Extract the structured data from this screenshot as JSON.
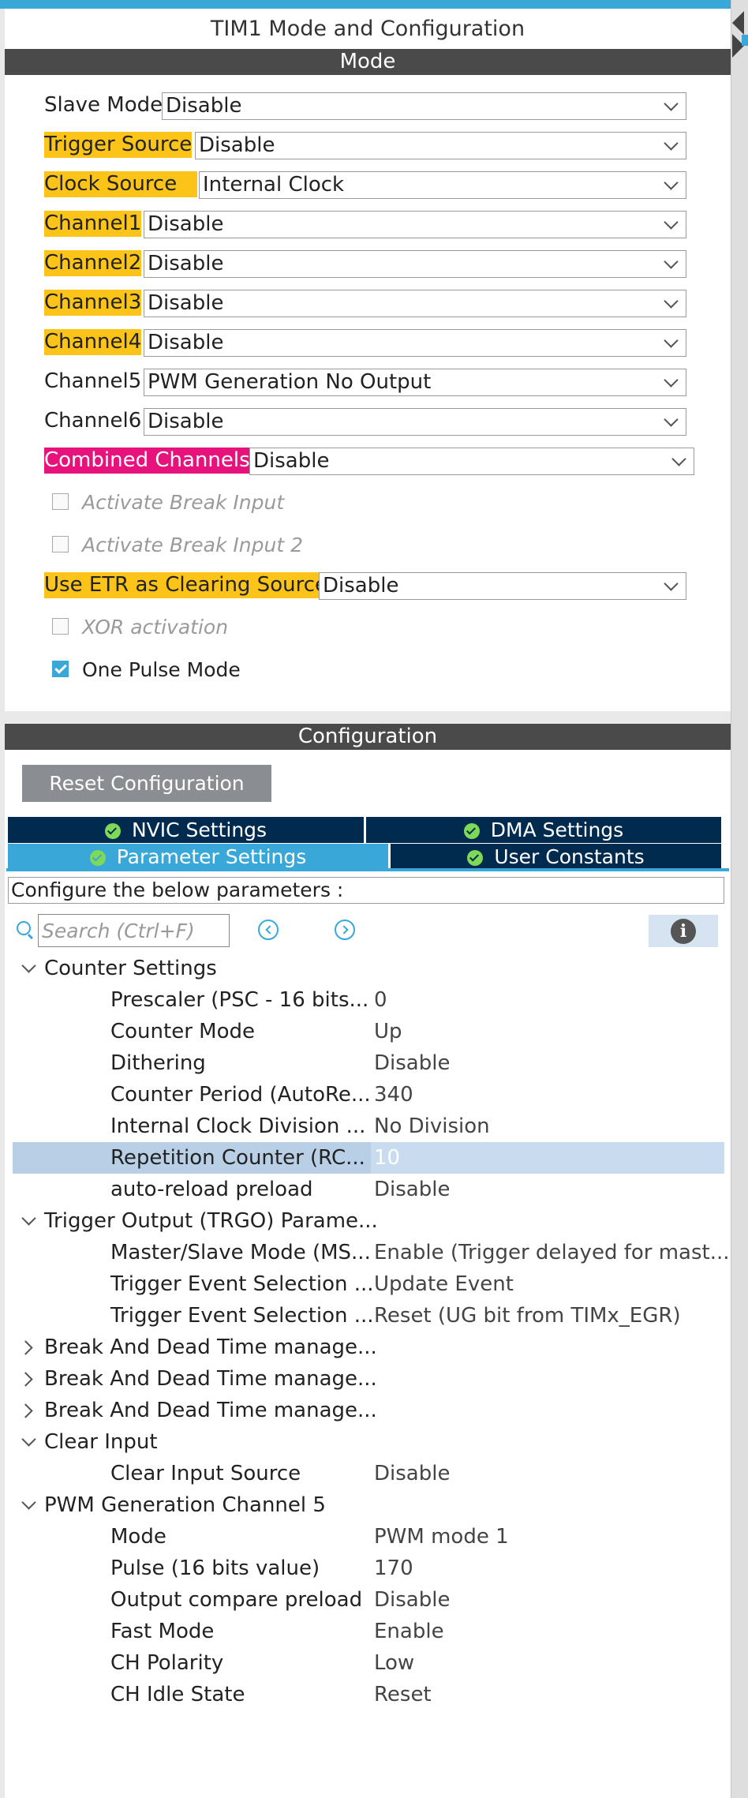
{
  "title": "TIM1 Mode and Configuration",
  "mode": {
    "section_title": "Mode",
    "rows": [
      {
        "label": "Slave Mode",
        "value": "Disable",
        "highlight": "none"
      },
      {
        "label": "Trigger Source",
        "value": "Disable",
        "highlight": "yellow"
      },
      {
        "label": "Clock Source",
        "value": "Internal Clock",
        "highlight": "yellow"
      },
      {
        "label": "Channel1",
        "value": "Disable",
        "highlight": "yellow"
      },
      {
        "label": "Channel2",
        "value": "Disable",
        "highlight": "yellow"
      },
      {
        "label": "Channel3",
        "value": "Disable",
        "highlight": "yellow"
      },
      {
        "label": "Channel4",
        "value": "Disable",
        "highlight": "yellow"
      },
      {
        "label": "Channel5",
        "value": "PWM Generation No Output",
        "highlight": "none"
      },
      {
        "label": "Channel6",
        "value": "Disable",
        "highlight": "none"
      },
      {
        "label": "Combined Channels",
        "value": "Disable",
        "highlight": "pink"
      }
    ],
    "checkboxes": [
      {
        "label": "Activate Break Input",
        "checked": false,
        "enabled": false
      },
      {
        "label": "Activate Break Input 2",
        "checked": false,
        "enabled": false
      }
    ],
    "etr": {
      "label": "Use ETR as Clearing Source",
      "value": "Disable",
      "highlight": "yellow"
    },
    "checkboxes2": [
      {
        "label": "XOR activation",
        "checked": false,
        "enabled": false
      },
      {
        "label": "One Pulse Mode",
        "checked": true,
        "enabled": true
      }
    ]
  },
  "configuration": {
    "section_title": "Configuration",
    "reset_label": "Reset Configuration",
    "tabs": {
      "nvic": "NVIC Settings",
      "dma": "DMA Settings",
      "params": "Parameter Settings",
      "user": "User Constants"
    },
    "active_tab": "params",
    "params_label": "Configure the below parameters :",
    "search_placeholder": "Search (Ctrl+F)",
    "groups": [
      {
        "title": "Counter Settings",
        "expanded": true,
        "params": [
          {
            "name": "Prescaler (PSC - 16 bits...",
            "value": "0"
          },
          {
            "name": "Counter Mode",
            "value": "Up"
          },
          {
            "name": "Dithering",
            "value": "Disable"
          },
          {
            "name": "Counter Period (AutoRe...",
            "value": "340"
          },
          {
            "name": "Internal Clock Division ...",
            "value": "No Division"
          },
          {
            "name": "Repetition Counter (RC...",
            "value": "10",
            "selected": true
          },
          {
            "name": "auto-reload preload",
            "value": "Disable"
          }
        ]
      },
      {
        "title": "Trigger Output (TRGO) Parame...",
        "expanded": true,
        "params": [
          {
            "name": "Master/Slave Mode (MS...",
            "value": "Enable (Trigger delayed for mast..."
          },
          {
            "name": "Trigger Event Selection ...",
            "value": "Update Event"
          },
          {
            "name": "Trigger Event Selection ...",
            "value": "Reset (UG bit from TIMx_EGR)"
          }
        ]
      },
      {
        "title": "Break And Dead Time manage...",
        "expanded": false,
        "params": []
      },
      {
        "title": "Break And Dead Time manage...",
        "expanded": false,
        "params": []
      },
      {
        "title": "Break And Dead Time manage...",
        "expanded": false,
        "params": []
      },
      {
        "title": "Clear Input",
        "expanded": true,
        "params": [
          {
            "name": "Clear Input Source",
            "value": "Disable"
          }
        ]
      },
      {
        "title": "PWM Generation Channel 5",
        "expanded": true,
        "params": [
          {
            "name": "Mode",
            "value": "PWM mode 1"
          },
          {
            "name": "Pulse (16 bits value)",
            "value": "170"
          },
          {
            "name": "Output compare preload",
            "value": "Disable"
          },
          {
            "name": "Fast Mode",
            "value": "Enable"
          },
          {
            "name": "CH Polarity",
            "value": "Low"
          },
          {
            "name": "CH Idle State",
            "value": "Reset"
          }
        ]
      }
    ]
  }
}
